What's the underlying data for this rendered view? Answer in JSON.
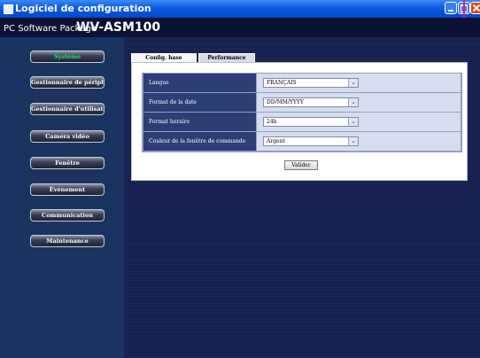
{
  "window": {
    "title": "Logiciel de configuration"
  },
  "header": {
    "package_label": "PC Software Package",
    "product_name": "WV-ASM100"
  },
  "sidebar": {
    "items": [
      {
        "label": "Système",
        "active": true
      },
      {
        "label": "Gestionnaire de périphérique",
        "active": false
      },
      {
        "label": "Gestionnaire d'utilisateur",
        "active": false
      },
      {
        "label": "Caméra vidéo",
        "active": false
      },
      {
        "label": "Fenêtre",
        "active": false
      },
      {
        "label": "Événement",
        "active": false
      },
      {
        "label": "Communication",
        "active": false
      },
      {
        "label": "Maintenance",
        "active": false
      }
    ]
  },
  "tabs": [
    {
      "label": "Config. base",
      "active": true
    },
    {
      "label": "Performance",
      "active": false
    }
  ],
  "settings": [
    {
      "label": "Langue",
      "value": "FRANÇAIS"
    },
    {
      "label": "Format de la date",
      "value": "DD/MM/YYYY"
    },
    {
      "label": "Format horaire",
      "value": "24h"
    },
    {
      "label": "Couleur de la fenêtre de commande",
      "value": "Argent"
    }
  ],
  "actions": {
    "validate_label": "Valider"
  },
  "colors": {
    "active_nav_text": "#2de061",
    "close_highlight": "#e0197d",
    "titlebar": "#0a5ae0"
  }
}
